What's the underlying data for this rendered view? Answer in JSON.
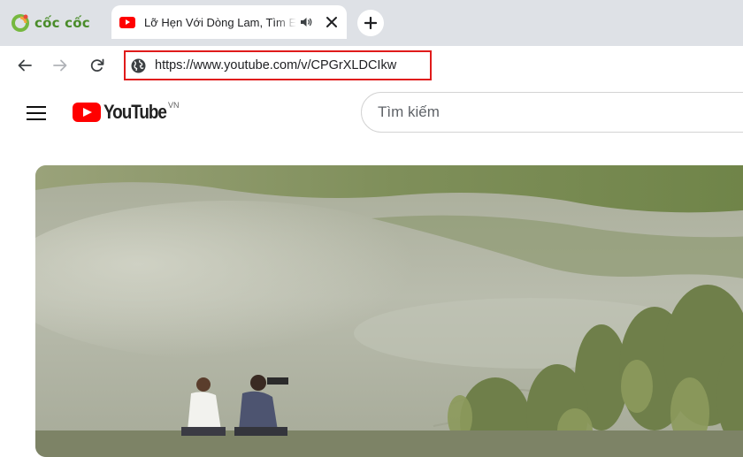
{
  "browser": {
    "brand_name": "cốc cốc",
    "tab": {
      "title": "Lỡ Hẹn Với Dòng Lam, Tìm Em",
      "favicon": "youtube-favicon",
      "audio_icon": "speaker-icon"
    },
    "new_tab_icon": "plus-icon",
    "address_bar": {
      "url": "https://www.youtube.com/v/CPGrXLDCIkw",
      "site_icon": "globe-icon",
      "highlight_color": "#e01b1b"
    }
  },
  "youtube": {
    "logo_text": "YouTube",
    "region": "VN",
    "search_placeholder": "Tìm kiếm",
    "brand_color": "#ff0000"
  }
}
